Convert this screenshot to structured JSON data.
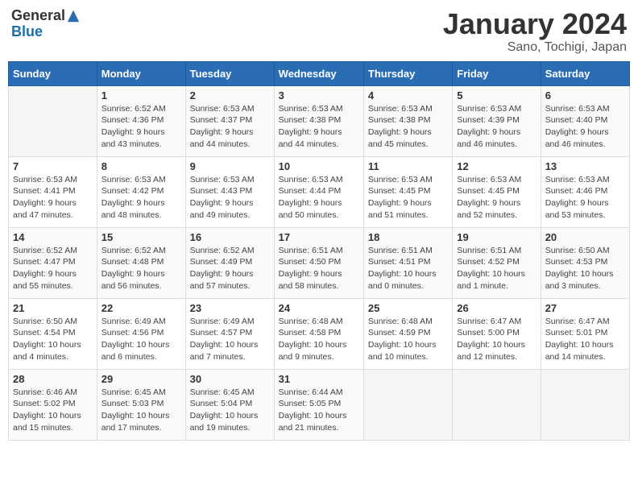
{
  "header": {
    "logo_general": "General",
    "logo_blue": "Blue",
    "month_year": "January 2024",
    "location": "Sano, Tochigi, Japan"
  },
  "days_of_week": [
    "Sunday",
    "Monday",
    "Tuesday",
    "Wednesday",
    "Thursday",
    "Friday",
    "Saturday"
  ],
  "weeks": [
    [
      {
        "num": "",
        "info": ""
      },
      {
        "num": "1",
        "info": "Sunrise: 6:52 AM\nSunset: 4:36 PM\nDaylight: 9 hours\nand 43 minutes."
      },
      {
        "num": "2",
        "info": "Sunrise: 6:53 AM\nSunset: 4:37 PM\nDaylight: 9 hours\nand 44 minutes."
      },
      {
        "num": "3",
        "info": "Sunrise: 6:53 AM\nSunset: 4:38 PM\nDaylight: 9 hours\nand 44 minutes."
      },
      {
        "num": "4",
        "info": "Sunrise: 6:53 AM\nSunset: 4:38 PM\nDaylight: 9 hours\nand 45 minutes."
      },
      {
        "num": "5",
        "info": "Sunrise: 6:53 AM\nSunset: 4:39 PM\nDaylight: 9 hours\nand 46 minutes."
      },
      {
        "num": "6",
        "info": "Sunrise: 6:53 AM\nSunset: 4:40 PM\nDaylight: 9 hours\nand 46 minutes."
      }
    ],
    [
      {
        "num": "7",
        "info": "Sunrise: 6:53 AM\nSunset: 4:41 PM\nDaylight: 9 hours\nand 47 minutes."
      },
      {
        "num": "8",
        "info": "Sunrise: 6:53 AM\nSunset: 4:42 PM\nDaylight: 9 hours\nand 48 minutes."
      },
      {
        "num": "9",
        "info": "Sunrise: 6:53 AM\nSunset: 4:43 PM\nDaylight: 9 hours\nand 49 minutes."
      },
      {
        "num": "10",
        "info": "Sunrise: 6:53 AM\nSunset: 4:44 PM\nDaylight: 9 hours\nand 50 minutes."
      },
      {
        "num": "11",
        "info": "Sunrise: 6:53 AM\nSunset: 4:45 PM\nDaylight: 9 hours\nand 51 minutes."
      },
      {
        "num": "12",
        "info": "Sunrise: 6:53 AM\nSunset: 4:45 PM\nDaylight: 9 hours\nand 52 minutes."
      },
      {
        "num": "13",
        "info": "Sunrise: 6:53 AM\nSunset: 4:46 PM\nDaylight: 9 hours\nand 53 minutes."
      }
    ],
    [
      {
        "num": "14",
        "info": "Sunrise: 6:52 AM\nSunset: 4:47 PM\nDaylight: 9 hours\nand 55 minutes."
      },
      {
        "num": "15",
        "info": "Sunrise: 6:52 AM\nSunset: 4:48 PM\nDaylight: 9 hours\nand 56 minutes."
      },
      {
        "num": "16",
        "info": "Sunrise: 6:52 AM\nSunset: 4:49 PM\nDaylight: 9 hours\nand 57 minutes."
      },
      {
        "num": "17",
        "info": "Sunrise: 6:51 AM\nSunset: 4:50 PM\nDaylight: 9 hours\nand 58 minutes."
      },
      {
        "num": "18",
        "info": "Sunrise: 6:51 AM\nSunset: 4:51 PM\nDaylight: 10 hours\nand 0 minutes."
      },
      {
        "num": "19",
        "info": "Sunrise: 6:51 AM\nSunset: 4:52 PM\nDaylight: 10 hours\nand 1 minute."
      },
      {
        "num": "20",
        "info": "Sunrise: 6:50 AM\nSunset: 4:53 PM\nDaylight: 10 hours\nand 3 minutes."
      }
    ],
    [
      {
        "num": "21",
        "info": "Sunrise: 6:50 AM\nSunset: 4:54 PM\nDaylight: 10 hours\nand 4 minutes."
      },
      {
        "num": "22",
        "info": "Sunrise: 6:49 AM\nSunset: 4:56 PM\nDaylight: 10 hours\nand 6 minutes."
      },
      {
        "num": "23",
        "info": "Sunrise: 6:49 AM\nSunset: 4:57 PM\nDaylight: 10 hours\nand 7 minutes."
      },
      {
        "num": "24",
        "info": "Sunrise: 6:48 AM\nSunset: 4:58 PM\nDaylight: 10 hours\nand 9 minutes."
      },
      {
        "num": "25",
        "info": "Sunrise: 6:48 AM\nSunset: 4:59 PM\nDaylight: 10 hours\nand 10 minutes."
      },
      {
        "num": "26",
        "info": "Sunrise: 6:47 AM\nSunset: 5:00 PM\nDaylight: 10 hours\nand 12 minutes."
      },
      {
        "num": "27",
        "info": "Sunrise: 6:47 AM\nSunset: 5:01 PM\nDaylight: 10 hours\nand 14 minutes."
      }
    ],
    [
      {
        "num": "28",
        "info": "Sunrise: 6:46 AM\nSunset: 5:02 PM\nDaylight: 10 hours\nand 15 minutes."
      },
      {
        "num": "29",
        "info": "Sunrise: 6:45 AM\nSunset: 5:03 PM\nDaylight: 10 hours\nand 17 minutes."
      },
      {
        "num": "30",
        "info": "Sunrise: 6:45 AM\nSunset: 5:04 PM\nDaylight: 10 hours\nand 19 minutes."
      },
      {
        "num": "31",
        "info": "Sunrise: 6:44 AM\nSunset: 5:05 PM\nDaylight: 10 hours\nand 21 minutes."
      },
      {
        "num": "",
        "info": ""
      },
      {
        "num": "",
        "info": ""
      },
      {
        "num": "",
        "info": ""
      }
    ]
  ]
}
